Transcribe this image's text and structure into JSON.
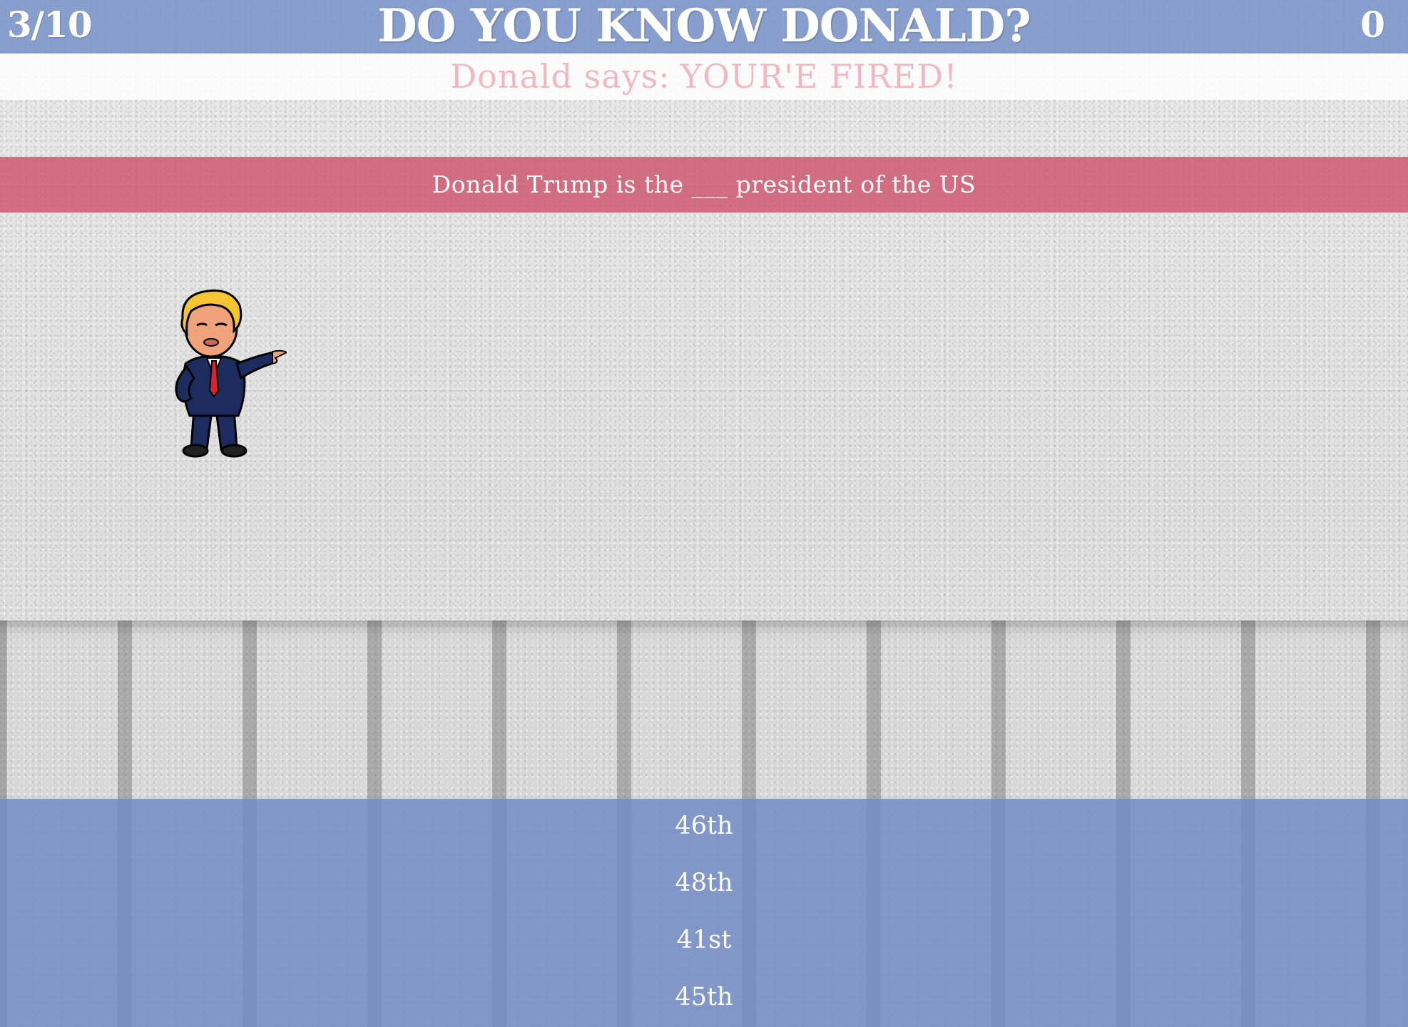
{
  "header": {
    "progress": "3/10",
    "title": "DO YOU KNOW DONALD?",
    "score": "0"
  },
  "says": {
    "prefix": "Donald says:",
    "message": "YOUR'E FIRED!"
  },
  "question": {
    "text": "Donald Trump is the ___ president of the US"
  },
  "answers": [
    "46th",
    "48th",
    "41st",
    "45th"
  ],
  "colors": {
    "header_blue": "#7a93c8",
    "question_red": "#cd5069",
    "says_pink": "#f0b9c2",
    "answers_blue": "#738cc6"
  },
  "icons": {
    "character": "trump-cartoon-icon"
  }
}
